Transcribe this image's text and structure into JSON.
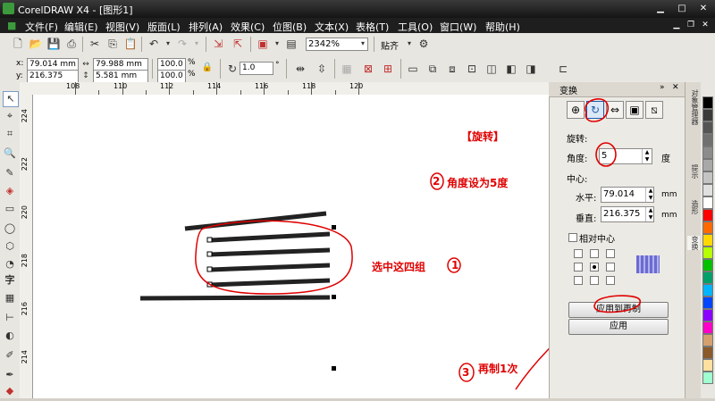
{
  "window": {
    "title": "CorelDRAW X4 - [图形1]"
  },
  "menu": [
    "文件(F)",
    "编辑(E)",
    "视图(V)",
    "版面(L)",
    "排列(A)",
    "效果(C)",
    "位图(B)",
    "文本(X)",
    "表格(T)",
    "工具(O)",
    "窗口(W)",
    "帮助(H)"
  ],
  "toolbar1": {
    "zoom": "2342%",
    "snap_label": "贴齐"
  },
  "propertybar": {
    "x": "79.014 mm",
    "y": "216.375 mm",
    "width": "79.988 mm",
    "height": "5.581 mm",
    "scale_w": "100.0",
    "scale_h": "100.0",
    "percent": "%",
    "rotation": "1.0",
    "degree": "°"
  },
  "ruler": {
    "h_ticks": [
      "108",
      "110",
      "112",
      "114",
      "116",
      "118",
      "120"
    ],
    "v_ticks": [
      "224",
      "222",
      "220",
      "218",
      "216",
      "214"
    ]
  },
  "docker": {
    "title": "变换",
    "section": "旋转:",
    "angle_label": "角度:",
    "angle_value": "5",
    "angle_unit": "度",
    "center_label": "中心:",
    "h_label": "水平:",
    "h_value": "79.014",
    "v_label": "垂直:",
    "v_value": "216.375",
    "unit": "mm",
    "relative_center": "相对中心",
    "apply_duplicate": "应用到再制",
    "apply": "应用"
  },
  "side_tabs": [
    "对象管理器",
    "提示",
    "造形",
    "变换"
  ],
  "annotations": {
    "rotate": "【旋转】",
    "step2": "角度设为5度",
    "step1": "选中这四组",
    "step3": "再制1次",
    "num1": "1",
    "num2": "2",
    "num3": "3"
  },
  "palette": [
    "#000000",
    "#3a3a3a",
    "#555555",
    "#707070",
    "#8c8c8c",
    "#a8a8a8",
    "#c4c4c4",
    "#e0e0e0",
    "#ffffff",
    "#ff0000",
    "#ff6a00",
    "#ffd800",
    "#b6ff00",
    "#00c000",
    "#00a06a",
    "#00b4ff",
    "#0046ff",
    "#8a00ff",
    "#ff00c8",
    "#d4a070",
    "#8a5a2a",
    "#ffe0a0",
    "#a0ffd0"
  ],
  "colors": {
    "annotation_red": "#e00000",
    "rotate_icon_blue": "#1e5aa8"
  }
}
